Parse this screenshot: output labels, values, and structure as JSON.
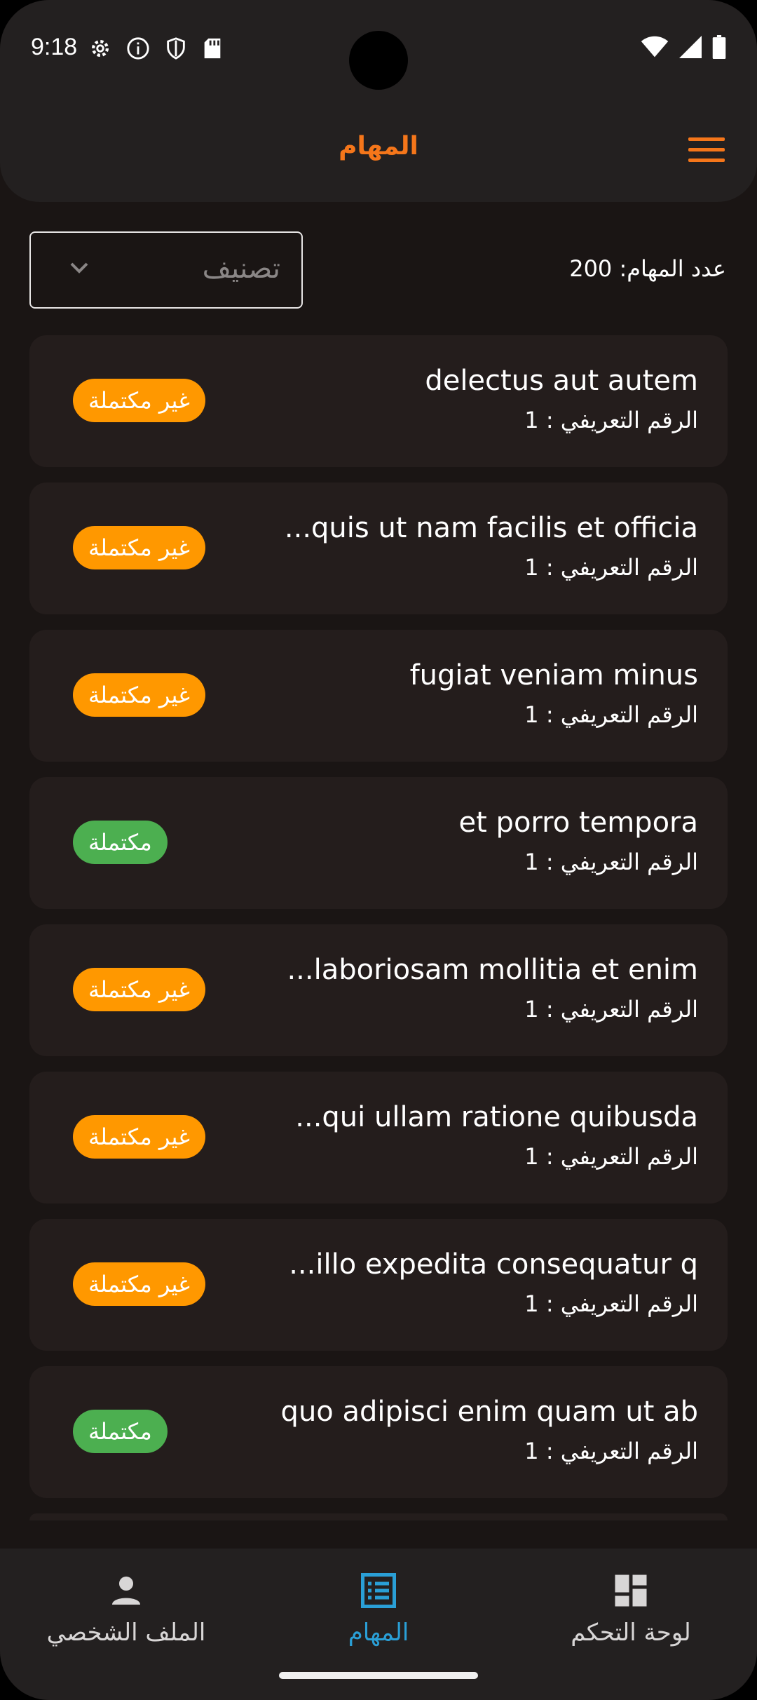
{
  "status_bar": {
    "time": "9:18"
  },
  "app_bar": {
    "title": "المهام"
  },
  "filter": {
    "count_label": "عدد المهام: 200",
    "dropdown_label": "تصنيف"
  },
  "tasks": [
    {
      "title": "delectus aut autem",
      "id_label": "الرقم التعريفي : 1",
      "status": "غير مكتملة",
      "status_type": "pending"
    },
    {
      "title": "...quis ut nam facilis et officia",
      "id_label": "الرقم التعريفي : 1",
      "status": "غير مكتملة",
      "status_type": "pending"
    },
    {
      "title": "fugiat veniam minus",
      "id_label": "الرقم التعريفي : 1",
      "status": "غير مكتملة",
      "status_type": "pending"
    },
    {
      "title": "et porro tempora",
      "id_label": "الرقم التعريفي : 1",
      "status": "مكتملة",
      "status_type": "done"
    },
    {
      "title": "...laboriosam mollitia et enim",
      "id_label": "الرقم التعريفي : 1",
      "status": "غير مكتملة",
      "status_type": "pending"
    },
    {
      "title": "...qui ullam ratione quibusda",
      "id_label": "الرقم التعريفي : 1",
      "status": "غير مكتملة",
      "status_type": "pending"
    },
    {
      "title": "...illo expedita consequatur q",
      "id_label": "الرقم التعريفي : 1",
      "status": "غير مكتملة",
      "status_type": "pending"
    },
    {
      "title": "quo adipisci enim quam ut ab",
      "id_label": "الرقم التعريفي : 1",
      "status": "مكتملة",
      "status_type": "done"
    }
  ],
  "bottom_nav": {
    "items": [
      {
        "label": "الملف الشخصي",
        "icon": "person-icon"
      },
      {
        "label": "المهام",
        "icon": "list-icon",
        "active": true
      },
      {
        "label": "لوحة التحكم",
        "icon": "dashboard-icon"
      }
    ]
  },
  "colors": {
    "accent": "#f5761a",
    "pending": "#ff9800",
    "done": "#4caf50",
    "nav_active": "#2a9fd6"
  }
}
